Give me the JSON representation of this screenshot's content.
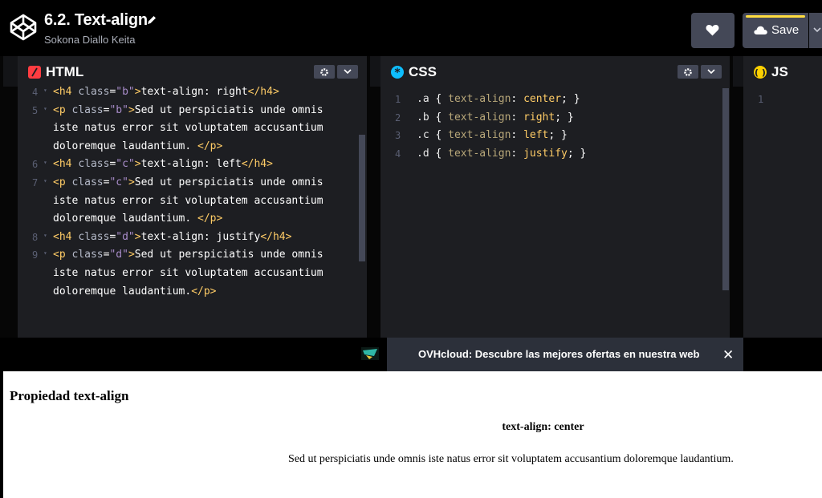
{
  "header": {
    "title": "6.2. Text-align",
    "author": "Sokona Diallo Keita",
    "save_label": "Save",
    "accent_color": "#ffdd40"
  },
  "panes": {
    "html": {
      "label": "HTML",
      "icon": "html-icon",
      "icon_color": "#ff3c41",
      "lines": [
        {
          "num": "4",
          "text": "<h4 class=\"b\">text-align: right</h4>"
        },
        {
          "num": "5",
          "text": "<p class=\"b\">Sed ut perspiciatis unde omnis"
        },
        {
          "num": "",
          "text": "iste natus error sit voluptatem accusantium"
        },
        {
          "num": "",
          "text": "doloremque laudantium. </p>"
        },
        {
          "num": "6",
          "text": "<h4 class=\"c\">text-align: left</h4>"
        },
        {
          "num": "7",
          "text": "<p class=\"c\">Sed ut perspiciatis unde omnis"
        },
        {
          "num": "",
          "text": "iste natus error sit voluptatem accusantium"
        },
        {
          "num": "",
          "text": "doloremque laudantium. </p>"
        },
        {
          "num": "8",
          "text": "<h4 class=\"d\">text-align: justify</h4>"
        },
        {
          "num": "9",
          "text": "<p class=\"d\">Sed ut perspiciatis unde omnis"
        },
        {
          "num": "",
          "text": "iste natus error sit voluptatem accusantium"
        },
        {
          "num": "",
          "text": "doloremque laudantium.</p>"
        }
      ]
    },
    "css": {
      "label": "CSS",
      "icon": "css-icon",
      "icon_color": "#0ebeff",
      "lines": [
        {
          "num": "1",
          "text": ".a { text-align: center; }"
        },
        {
          "num": "2",
          "text": ".b { text-align: right; }"
        },
        {
          "num": "3",
          "text": ".c { text-align: left; }"
        },
        {
          "num": "4",
          "text": ".d { text-align: justify; }"
        }
      ]
    },
    "js": {
      "label": "JS",
      "icon": "js-icon",
      "icon_color": "#fcd000",
      "lines": [
        {
          "num": "1",
          "text": ""
        }
      ]
    }
  },
  "ad": {
    "text": "OVHcloud: Descubre las mejores ofertas en nuestra web",
    "close": "✕"
  },
  "result": {
    "heading": "Propiedad text-align",
    "subheading": "text-align: center",
    "paragraph": "Sed ut perspiciatis unde omnis iste natus error sit voluptatem accusantium doloremque laudantium."
  }
}
